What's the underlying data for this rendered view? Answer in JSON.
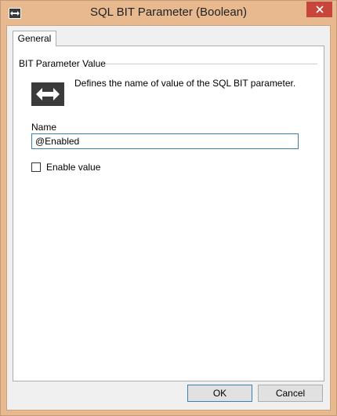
{
  "window": {
    "title": "SQL BIT Parameter (Boolean)"
  },
  "tabs": [
    {
      "label": "General",
      "selected": true
    }
  ],
  "group": {
    "title": "BIT Parameter Value",
    "description": "Defines the name of value of the SQL BIT parameter."
  },
  "name_field": {
    "label": "Name",
    "value": "@Enabled"
  },
  "enable_checkbox": {
    "label": "Enable value",
    "checked": false
  },
  "buttons": {
    "ok": "OK",
    "cancel": "Cancel"
  },
  "icons": {
    "app": "bidirectional-arrow-icon",
    "close": "close-icon",
    "parameter": "bidirectional-arrow-icon"
  }
}
